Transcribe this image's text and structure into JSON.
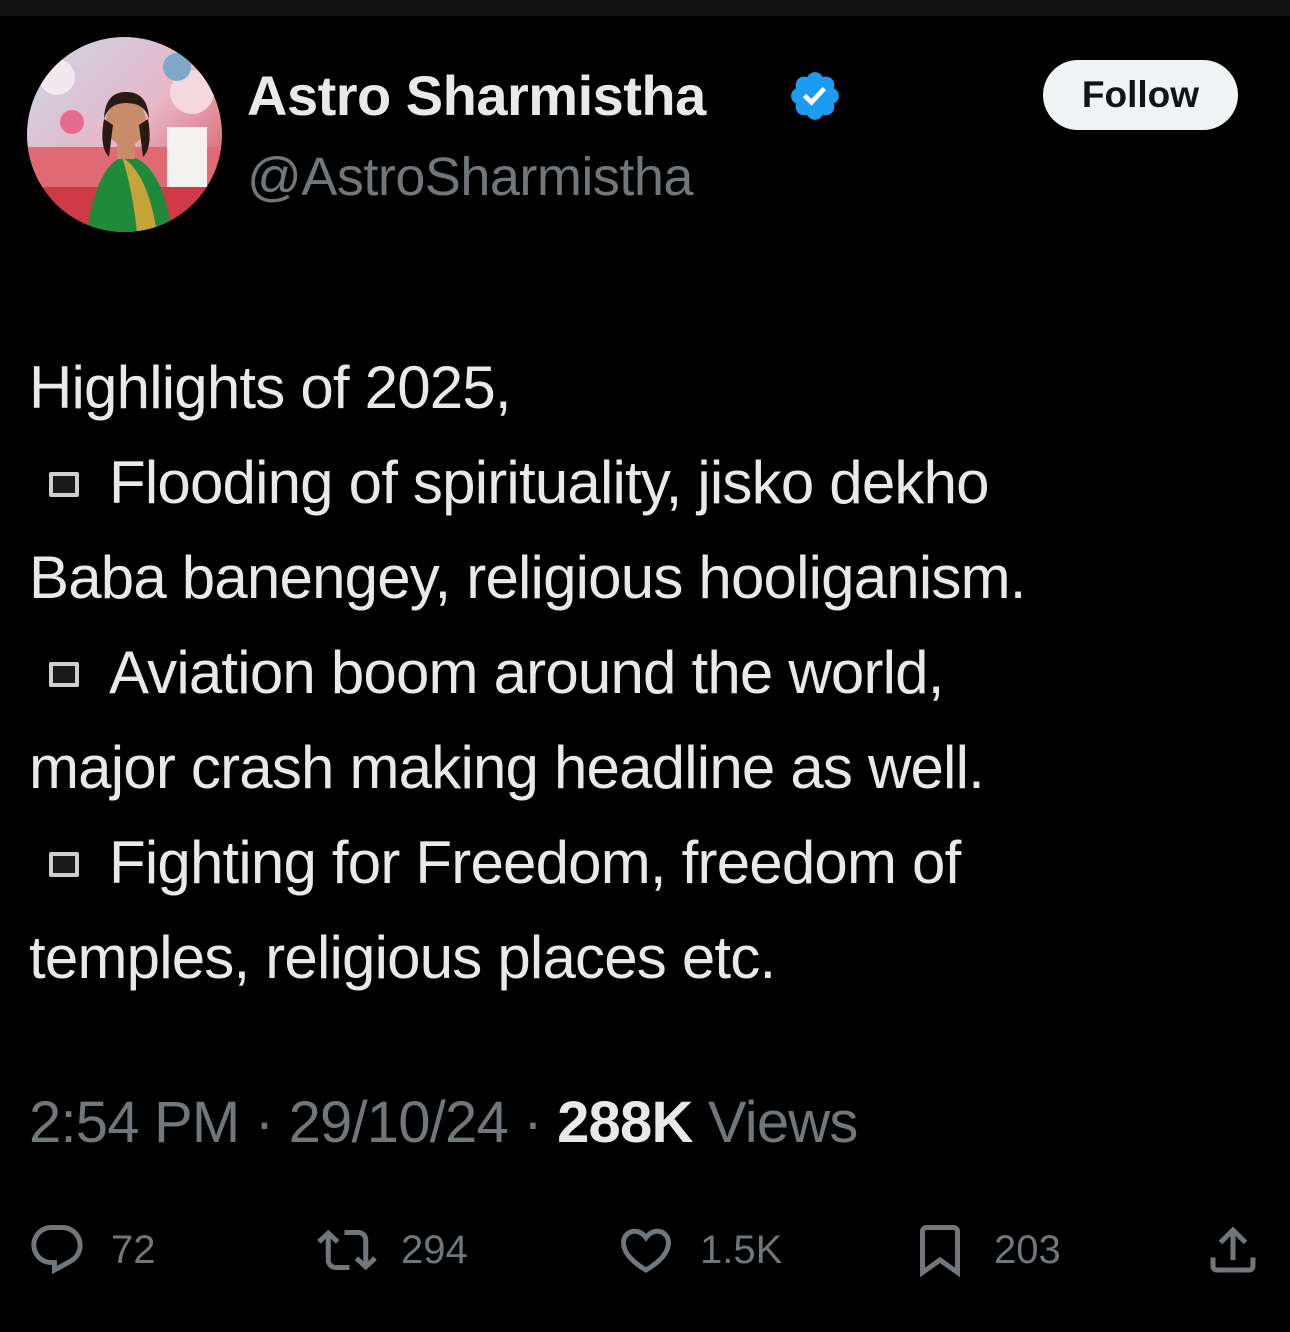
{
  "author": {
    "display_name": "Astro Sharmistha",
    "handle": "@AstroSharmistha",
    "verified_icon": "verified-badge-icon"
  },
  "follow_button": {
    "label": "Follow"
  },
  "tweet": {
    "lines": [
      {
        "bullet": false,
        "text": "Highlights of 2025,"
      },
      {
        "bullet": true,
        "text": "Flooding of spirituality, jisko dekho"
      },
      {
        "bullet": false,
        "text": "Baba banengey, religious hooliganism."
      },
      {
        "bullet": true,
        "text": "Aviation boom around the world,"
      },
      {
        "bullet": false,
        "text": "major crash making headline as well."
      },
      {
        "bullet": true,
        "text": "Fighting for Freedom, freedom of"
      },
      {
        "bullet": false,
        "text": "temples, religious places etc."
      }
    ]
  },
  "meta": {
    "time": "2:54 PM",
    "separator": " · ",
    "date": "29/10/24",
    "views_count": "288K",
    "views_label": "Views"
  },
  "actions": {
    "replies": {
      "icon": "reply-icon",
      "count": "72"
    },
    "reposts": {
      "icon": "repost-icon",
      "count": "294"
    },
    "likes": {
      "icon": "heart-icon",
      "count": "1.5K"
    },
    "bookmarks": {
      "icon": "bookmark-icon",
      "count": "203"
    },
    "share": {
      "icon": "share-icon"
    }
  },
  "colors": {
    "background": "#000000",
    "primary_text": "#e7e9ea",
    "secondary_text": "#71767b",
    "verified_blue": "#1d9bf0",
    "follow_button_bg": "#eff3f4"
  }
}
